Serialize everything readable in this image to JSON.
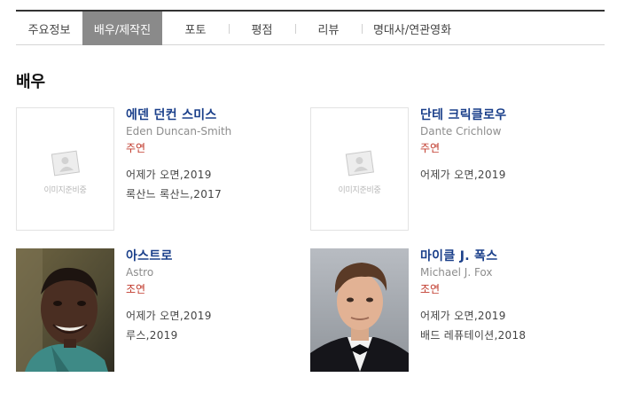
{
  "tabs": [
    {
      "label": "주요정보",
      "active": false
    },
    {
      "label": "배우/제작진",
      "active": true
    },
    {
      "label": "포토",
      "active": false
    },
    {
      "label": "평점",
      "active": false
    },
    {
      "label": "리뷰",
      "active": false
    },
    {
      "label": "명대사/연관영화",
      "active": false
    }
  ],
  "section": {
    "title": "배우"
  },
  "placeholder_text": "이미지준비중",
  "actors": [
    {
      "name": "에덴 던컨 스미스",
      "en_name": "Eden Duncan-Smith",
      "role": "주연",
      "works": [
        "어제가 오면,2019",
        "록산느 록산느,2017"
      ],
      "photo": "placeholder"
    },
    {
      "name": "단테 크릭클로우",
      "en_name": "Dante Crichlow",
      "role": "주연",
      "works": [
        "어제가 오면,2019"
      ],
      "photo": "placeholder"
    },
    {
      "name": "아스트로",
      "en_name": "Astro",
      "role": "조연",
      "works": [
        "어제가 오면,2019",
        "루스,2019"
      ],
      "photo": "young-smiling-man-portrait"
    },
    {
      "name": "마이클 J. 폭스",
      "en_name": "Michael J. Fox",
      "role": "조연",
      "works": [
        "어제가 오면,2019",
        "배드 레퓨테이션,2018"
      ],
      "photo": "man-in-tuxedo-portrait"
    }
  ],
  "colors": {
    "name": "#1a3f8a",
    "role": "#c0392b",
    "active_tab": "#8a8a8a"
  }
}
